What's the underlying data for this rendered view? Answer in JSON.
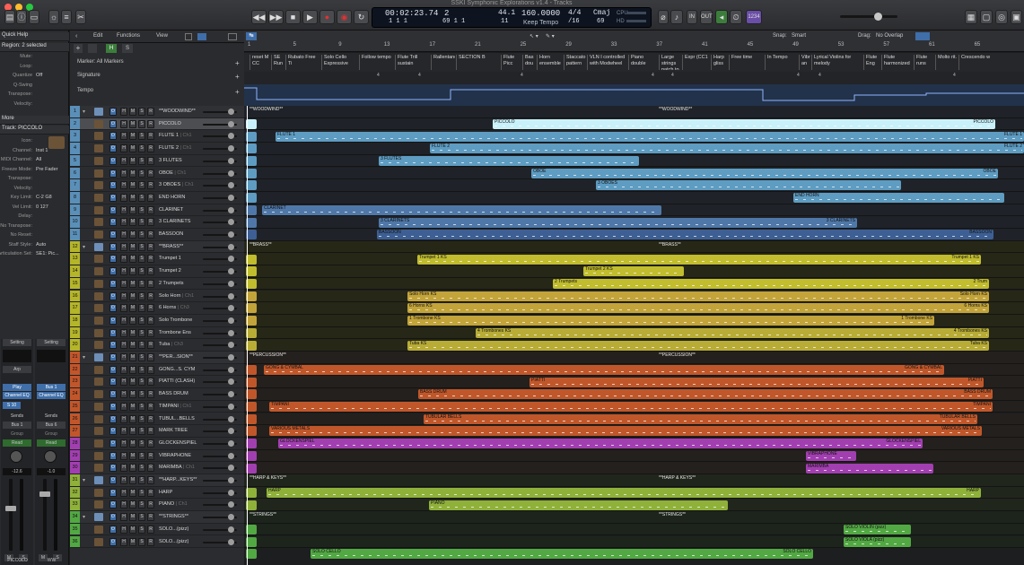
{
  "window": {
    "title": "SSKI Symphonic Explorations v1.4 - Tracks"
  },
  "colors": {
    "woodwind_folder": "#5a8fb8",
    "brass": "#b5b52a",
    "brass_alt": "#c8a232",
    "percussion": "#c2562b",
    "glockenspiel": "#a23fb0",
    "harp": "#8fb13a",
    "strings": "#52a843",
    "piccolo": "#bde9f5"
  },
  "toolbar": {
    "lcd": {
      "time": "00:02:23.74",
      "bars": "1 1 1",
      "beat_pos": "69 1 1",
      "bar": "1",
      "pos_top": "2",
      "pos_small": "1",
      "sample_rate_top": "44.1",
      "sample_rate_bot": "11",
      "tempo": "160.0000",
      "tempo_mode": "Keep Tempo",
      "time_sig": "4/4",
      "division": "/16",
      "key": "Cmaj",
      "key_bot": "69",
      "cpu_label": "CPU",
      "hd_label": "HD"
    },
    "bpm_badge": "1234"
  },
  "inspector": {
    "quick_help": "Quick Help",
    "region_header": "Region: 2 selected",
    "region_params": [
      [
        "Mute:",
        ""
      ],
      [
        "Loop:",
        ""
      ],
      [
        "Quantize",
        "Off"
      ],
      [
        "Q-Swing",
        ""
      ],
      [
        "Transpose:",
        ""
      ],
      [
        "Velocity:",
        ""
      ]
    ],
    "more": "More",
    "track_header": "Track:  PICCOLO",
    "track_params": [
      [
        "Icon:",
        ""
      ],
      [
        "Channel:",
        "Inst 1"
      ],
      [
        "MIDI Channel:",
        "All"
      ],
      [
        "Freeze Mode:",
        "Pre Fader"
      ],
      [
        "Transpose:",
        ""
      ],
      [
        "Velocity:",
        ""
      ],
      [
        "Key Limit:",
        "C-2  G8"
      ],
      [
        "Vel Limit:",
        "0  127"
      ],
      [
        "Delay:",
        ""
      ],
      [
        "No Transpose:",
        ""
      ],
      [
        "No Reset:",
        ""
      ],
      [
        "Staff Style:",
        "Auto"
      ],
      [
        "Articulation Set:",
        "SE1: Pic..."
      ]
    ],
    "strip_left": {
      "setting": "Setting",
      "eq": "Channel EQ",
      "plugin": "Play",
      "send": "Sends",
      "output": "Bus 1",
      "group": "Group",
      "auto": "Read",
      "volume": "-12.6",
      "name": "PICCOLO",
      "m": "M",
      "s": "S",
      "arp": "Arp",
      "midi_in": "S 10"
    },
    "strip_right": {
      "setting": "Setting",
      "eq": "Channel EQ",
      "plugin": "Bus 1",
      "send": "Sends",
      "output": "Bus 6",
      "group": "Group",
      "auto": "Read",
      "volume": "-1.0",
      "name": "WW",
      "m": "M",
      "s": "S"
    }
  },
  "tracks_header": {
    "edit": "Edit",
    "functions": "Functions",
    "view": "View",
    "h": "H",
    "s": "S"
  },
  "global_tracks": {
    "marker": "Marker: All Markers",
    "signature": "Signature",
    "tempo": "Tempo"
  },
  "tracks": [
    {
      "n": "1",
      "name": "**WOODWIND**",
      "ch": "",
      "folder": true
    },
    {
      "n": "2",
      "name": "PICCOLO",
      "ch": ""
    },
    {
      "n": "3",
      "name": "FLUTE 1",
      "ch": "Ch1"
    },
    {
      "n": "4",
      "name": "FLUTE 2",
      "ch": "Ch1"
    },
    {
      "n": "5",
      "name": "3 FLUTES",
      "ch": ""
    },
    {
      "n": "6",
      "name": "OBOE",
      "ch": "Ch1"
    },
    {
      "n": "7",
      "name": "3 OBOES",
      "ch": "Ch1"
    },
    {
      "n": "8",
      "name": "END HORN",
      "ch": ""
    },
    {
      "n": "9",
      "name": "CLARINET",
      "ch": ""
    },
    {
      "n": "10",
      "name": "3 CLARINETS",
      "ch": ""
    },
    {
      "n": "11",
      "name": "BASSOON",
      "ch": ""
    },
    {
      "n": "12",
      "name": "**BRASS**",
      "ch": "",
      "folder": true
    },
    {
      "n": "13",
      "name": "Trumpet 1",
      "ch": ""
    },
    {
      "n": "14",
      "name": "Trumpet 2",
      "ch": ""
    },
    {
      "n": "15",
      "name": "2 Trumpets",
      "ch": ""
    },
    {
      "n": "16",
      "name": "Solo Horn",
      "ch": "Ch1"
    },
    {
      "n": "17",
      "name": "6 Horns",
      "ch": "Ch3"
    },
    {
      "n": "18",
      "name": "Solo Trombone",
      "ch": ""
    },
    {
      "n": "19",
      "name": "Trombone Ens",
      "ch": ""
    },
    {
      "n": "20",
      "name": "Tuba",
      "ch": "Ch3"
    },
    {
      "n": "21",
      "name": "**PER...SION**",
      "ch": "",
      "folder": true
    },
    {
      "n": "22",
      "name": "GONG...S. CYM",
      "ch": ""
    },
    {
      "n": "23",
      "name": "PIATTI (CLASH)",
      "ch": ""
    },
    {
      "n": "24",
      "name": "BASS DRUM",
      "ch": ""
    },
    {
      "n": "25",
      "name": "TIMPANI",
      "ch": "Ch1"
    },
    {
      "n": "26",
      "name": "TUBUL...BELLS",
      "ch": ""
    },
    {
      "n": "27",
      "name": "MARK TREE",
      "ch": ""
    },
    {
      "n": "28",
      "name": "GLOCKENSPIEL",
      "ch": ""
    },
    {
      "n": "29",
      "name": "VIBRAPHONE",
      "ch": ""
    },
    {
      "n": "30",
      "name": "MARIMBA",
      "ch": "Ch1"
    },
    {
      "n": "31",
      "name": "**HARP...KEYS**",
      "ch": "",
      "folder": true
    },
    {
      "n": "32",
      "name": "HARP",
      "ch": ""
    },
    {
      "n": "33",
      "name": "PIANO",
      "ch": "Ch1"
    },
    {
      "n": "34",
      "name": "**STRINGS**",
      "ch": "",
      "folder": true
    },
    {
      "n": "35",
      "name": "SOLO...(pizz)",
      "ch": ""
    },
    {
      "n": "36",
      "name": "SOLO...(pizz)",
      "ch": ""
    }
  ],
  "ruler": {
    "bars": [
      "1",
      "5",
      "9",
      "13",
      "17",
      "21",
      "25",
      "29",
      "33",
      "37",
      "41",
      "45",
      "49",
      "53",
      "57",
      "61",
      "65"
    ],
    "snap_label": "Snap:",
    "snap_value": "Smart",
    "drag_label": "Drag:",
    "drag_value": "No Overlap"
  },
  "markers": [
    "reset M CC",
    "SE Run",
    "Rubato Free Ti",
    "Solo Cello Expressive",
    "Follow tempo",
    "Flute Trill sustain",
    "Rallentando",
    "SECTION B",
    "Flute Picc",
    "Bas dou",
    "Horn ensemble",
    "Staccato pattern",
    "VLN I controlled with Modwheel",
    "Piano double",
    "Large strings patch to",
    "Expr (CC1",
    "Harp gliss",
    "Free time",
    "In Tempo",
    "Vibr an",
    "Lyrical Violins for melody",
    "Flute Eng",
    "Flute harmonized",
    "Flute runs",
    "Molto rit.",
    "Crescendo w"
  ],
  "sig_values": [
    "4",
    "4",
    "4",
    "4",
    "4",
    "4",
    "4",
    "4"
  ],
  "regions": [
    {
      "lane": 0,
      "label": "**WOODWIND**",
      "label2": "**WOODWIND**"
    },
    {
      "lane": 1,
      "label": "PICCOLO",
      "label2": "PICCOLO"
    },
    {
      "lane": 2,
      "label": "FLUTE 1",
      "label2": "FLUTE 1"
    },
    {
      "lane": 3,
      "label": "FLUTE 2",
      "label2": "FLUTE 2"
    },
    {
      "lane": 4,
      "label": "3 FLUTES",
      "label2": ""
    },
    {
      "lane": 5,
      "label": "OBOE",
      "label2": "OBOE"
    },
    {
      "lane": 6,
      "label": "3 OBOES",
      "label2": ""
    },
    {
      "lane": 7,
      "label": "END HORN",
      "label2": ""
    },
    {
      "lane": 8,
      "label": "CLARINET",
      "label2": ""
    },
    {
      "lane": 9,
      "label": "3 CLARINETS",
      "label2": "3 CLARINETS"
    },
    {
      "lane": 10,
      "label": "BASSOON",
      "label2": "BASSOON"
    },
    {
      "lane": 11,
      "label": "**BRASS**",
      "label2": "**BRASS**"
    },
    {
      "lane": 12,
      "label": "Trumpet 1 KS",
      "label2": "Trumpet 1 KS"
    },
    {
      "lane": 13,
      "label": "Trumpet 2 KS",
      "label2": ""
    },
    {
      "lane": 14,
      "label": "2 Trumpets",
      "label2": "2 Trum"
    },
    {
      "lane": 15,
      "label": "Solo Horn KS",
      "label2": "Solo Horn KS"
    },
    {
      "lane": 16,
      "label": "6 Horns KS",
      "label2": "6 Horns KS"
    },
    {
      "lane": 17,
      "label": "1 Trombone KS",
      "label2": "1 Trombone KS"
    },
    {
      "lane": 18,
      "label": "4 Trombones KS",
      "label2": "4 Trombones KS"
    },
    {
      "lane": 19,
      "label": "Tuba KS",
      "label2": "Tuba KS"
    },
    {
      "lane": 20,
      "label": "**PERCUSSION**",
      "label2": "**PERCUSSION**"
    },
    {
      "lane": 21,
      "label": "GONG & CYMBAL",
      "label2": "GONG & CYMBAL"
    },
    {
      "lane": 22,
      "label": "PIATTI",
      "label2": "PIATTI"
    },
    {
      "lane": 23,
      "label": "BASS DRUM",
      "label2": "BASS DRUM"
    },
    {
      "lane": 24,
      "label": "TIMPANI",
      "label2": "TIMPANI"
    },
    {
      "lane": 25,
      "label": "TUBULAR BELLS",
      "label2": "TUBULAR BELLS"
    },
    {
      "lane": 26,
      "label": "VARIOUS METALS",
      "label2": "VARIOUS METALS"
    },
    {
      "lane": 27,
      "label": "GLOCKENSPIEL",
      "label2": "GLOCKENSPIEL"
    },
    {
      "lane": 28,
      "label": "VIBRAPHONE",
      "label2": ""
    },
    {
      "lane": 29,
      "label": "MARIMBA",
      "label2": ""
    },
    {
      "lane": 30,
      "label": "**HARP & KEYS**",
      "label2": "**HARP & KEYS**"
    },
    {
      "lane": 31,
      "label": "HARP",
      "label2": "HARP"
    },
    {
      "lane": 32,
      "label": "PIANO",
      "label2": ""
    },
    {
      "lane": 33,
      "label": "**STRINGS**",
      "label2": "**STRINGS**"
    },
    {
      "lane": 34,
      "label": "SOLO VIOLIN (pizz)",
      "label2": ""
    },
    {
      "lane": 35,
      "label": "SOLO VIOLA (pizz)",
      "label2": ""
    },
    {
      "lane": 36,
      "label": "SOLO CELLO",
      "label2": "SOLO CELLO"
    }
  ]
}
